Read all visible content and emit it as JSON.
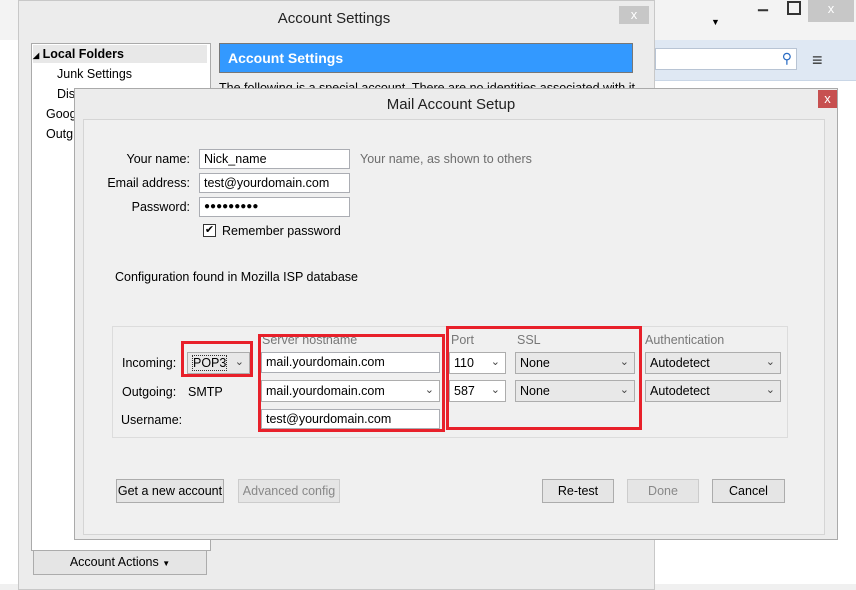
{
  "background_window": {
    "search_icon": "search-icon",
    "menu_icon": "hamburger-icon"
  },
  "account_settings": {
    "title": "Account Settings",
    "close": "x",
    "tree": [
      {
        "label": "Local Folders"
      },
      {
        "label": "Junk Settings"
      },
      {
        "label": "Dis"
      },
      {
        "label": "Goog"
      },
      {
        "label": "Outg"
      }
    ],
    "header": "Account Settings",
    "description": "The following is a special account. There are no identities associated with it.",
    "account_actions": "Account Actions"
  },
  "mail_setup": {
    "title": "Mail Account Setup",
    "close": "x",
    "name_label": "Your name:",
    "name_value": "Nick_name",
    "name_hint": "Your name, as shown to others",
    "email_label": "Email address:",
    "email_value": "test@yourdomain.com",
    "password_label": "Password:",
    "password_value": "●●●●●●●●●",
    "remember_label": "Remember password",
    "remember_checked": true,
    "config_status": "Configuration found in Mozilla ISP database",
    "headers": {
      "hostname": "Server hostname",
      "port": "Port",
      "ssl": "SSL",
      "auth": "Authentication"
    },
    "incoming": {
      "label": "Incoming:",
      "protocol": "POP3",
      "hostname": "mail.yourdomain.com",
      "port": "110",
      "ssl": "None",
      "auth": "Autodetect"
    },
    "outgoing": {
      "label": "Outgoing:",
      "protocol": "SMTP",
      "hostname": "mail.yourdomain.com",
      "port": "587",
      "ssl": "None",
      "auth": "Autodetect"
    },
    "username": {
      "label": "Username:",
      "value": "test@yourdomain.com"
    },
    "buttons": {
      "get_new": "Get a new account",
      "advanced": "Advanced config",
      "retest": "Re-test",
      "done": "Done",
      "cancel": "Cancel"
    },
    "highlight_color": "#e8202a"
  }
}
